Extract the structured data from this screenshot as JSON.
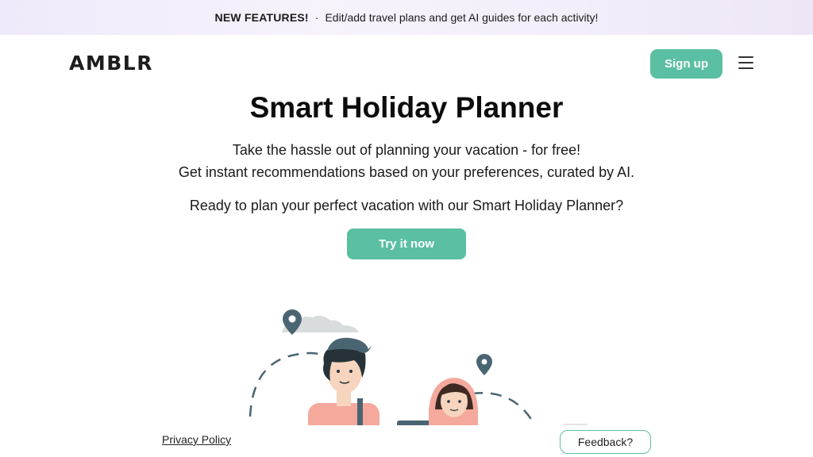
{
  "banner": {
    "highlight": "NEW FEATURES!",
    "separator": "·",
    "text": "Edit/add travel plans and get AI guides for each activity!"
  },
  "header": {
    "logo": "AMBLR",
    "signup_label": "Sign up",
    "menu_icon": "hamburger-icon"
  },
  "hero": {
    "title": "Smart Holiday Planner",
    "subtitle_line1": "Take the hassle out of planning your vacation - for free!",
    "subtitle_line2": "Get instant recommendations based on your preferences, curated by AI.",
    "question": "Ready to plan your perfect vacation with our Smart Holiday Planner?",
    "cta_label": "Try it now"
  },
  "footer": {
    "privacy_label": "Privacy Policy",
    "feedback_label": "Feedback?"
  },
  "colors": {
    "accent": "#5bbfa3",
    "pin": "#4a6572",
    "skin": "#f6d4bd",
    "shirt": "#f4a99c"
  }
}
